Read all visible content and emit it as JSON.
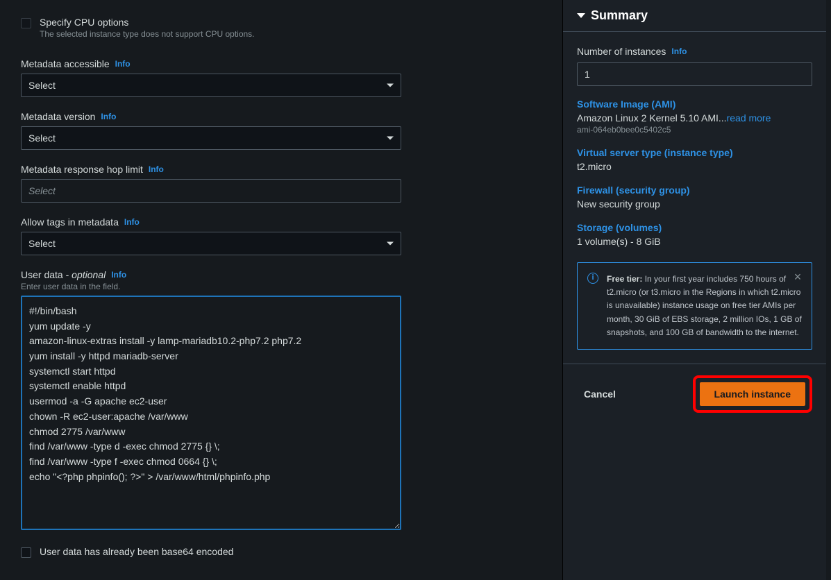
{
  "main": {
    "cpu": {
      "label": "Specify CPU options",
      "hint": "The selected instance type does not support CPU options."
    },
    "metadata_accessible": {
      "label": "Metadata accessible",
      "info": "Info",
      "value": "Select"
    },
    "metadata_version": {
      "label": "Metadata version",
      "info": "Info",
      "value": "Select"
    },
    "metadata_hop": {
      "label": "Metadata response hop limit",
      "info": "Info",
      "placeholder": "Select"
    },
    "allow_tags": {
      "label": "Allow tags in metadata",
      "info": "Info",
      "value": "Select"
    },
    "user_data": {
      "label_main": "User data",
      "label_sep": " - ",
      "label_optional": "optional",
      "info": "Info",
      "hint": "Enter user data in the field.",
      "value": "#!/bin/bash\nyum update -y\namazon-linux-extras install -y lamp-mariadb10.2-php7.2 php7.2\nyum install -y httpd mariadb-server\nsystemctl start httpd\nsystemctl enable httpd\nusermod -a -G apache ec2-user\nchown -R ec2-user:apache /var/www\nchmod 2775 /var/www\nfind /var/www -type d -exec chmod 2775 {} \\;\nfind /var/www -type f -exec chmod 0664 {} \\;\necho \"<?php phpinfo(); ?>\" > /var/www/html/phpinfo.php"
    },
    "base64_checkbox_label": "User data has already been base64 encoded"
  },
  "sidebar": {
    "title": "Summary",
    "num_instances": {
      "label": "Number of instances",
      "info": "Info",
      "value": "1"
    },
    "ami": {
      "label": "Software Image (AMI)",
      "value": "Amazon Linux 2 Kernel 5.10 AMI...",
      "readmore": "read more",
      "sub": "ami-064eb0bee0c5402c5"
    },
    "instance_type": {
      "label": "Virtual server type (instance type)",
      "value": "t2.micro"
    },
    "firewall": {
      "label": "Firewall (security group)",
      "value": "New security group"
    },
    "storage": {
      "label": "Storage (volumes)",
      "value": "1 volume(s) - 8 GiB"
    },
    "callout": {
      "strong": "Free tier:",
      "text": " In your first year includes 750 hours of t2.micro (or t3.micro in the Regions in which t2.micro is unavailable) instance usage on free tier AMIs per month, 30 GiB of EBS storage, 2 million IOs, 1 GB of snapshots, and 100 GB of bandwidth to the internet."
    },
    "footer": {
      "cancel": "Cancel",
      "launch": "Launch instance"
    }
  }
}
